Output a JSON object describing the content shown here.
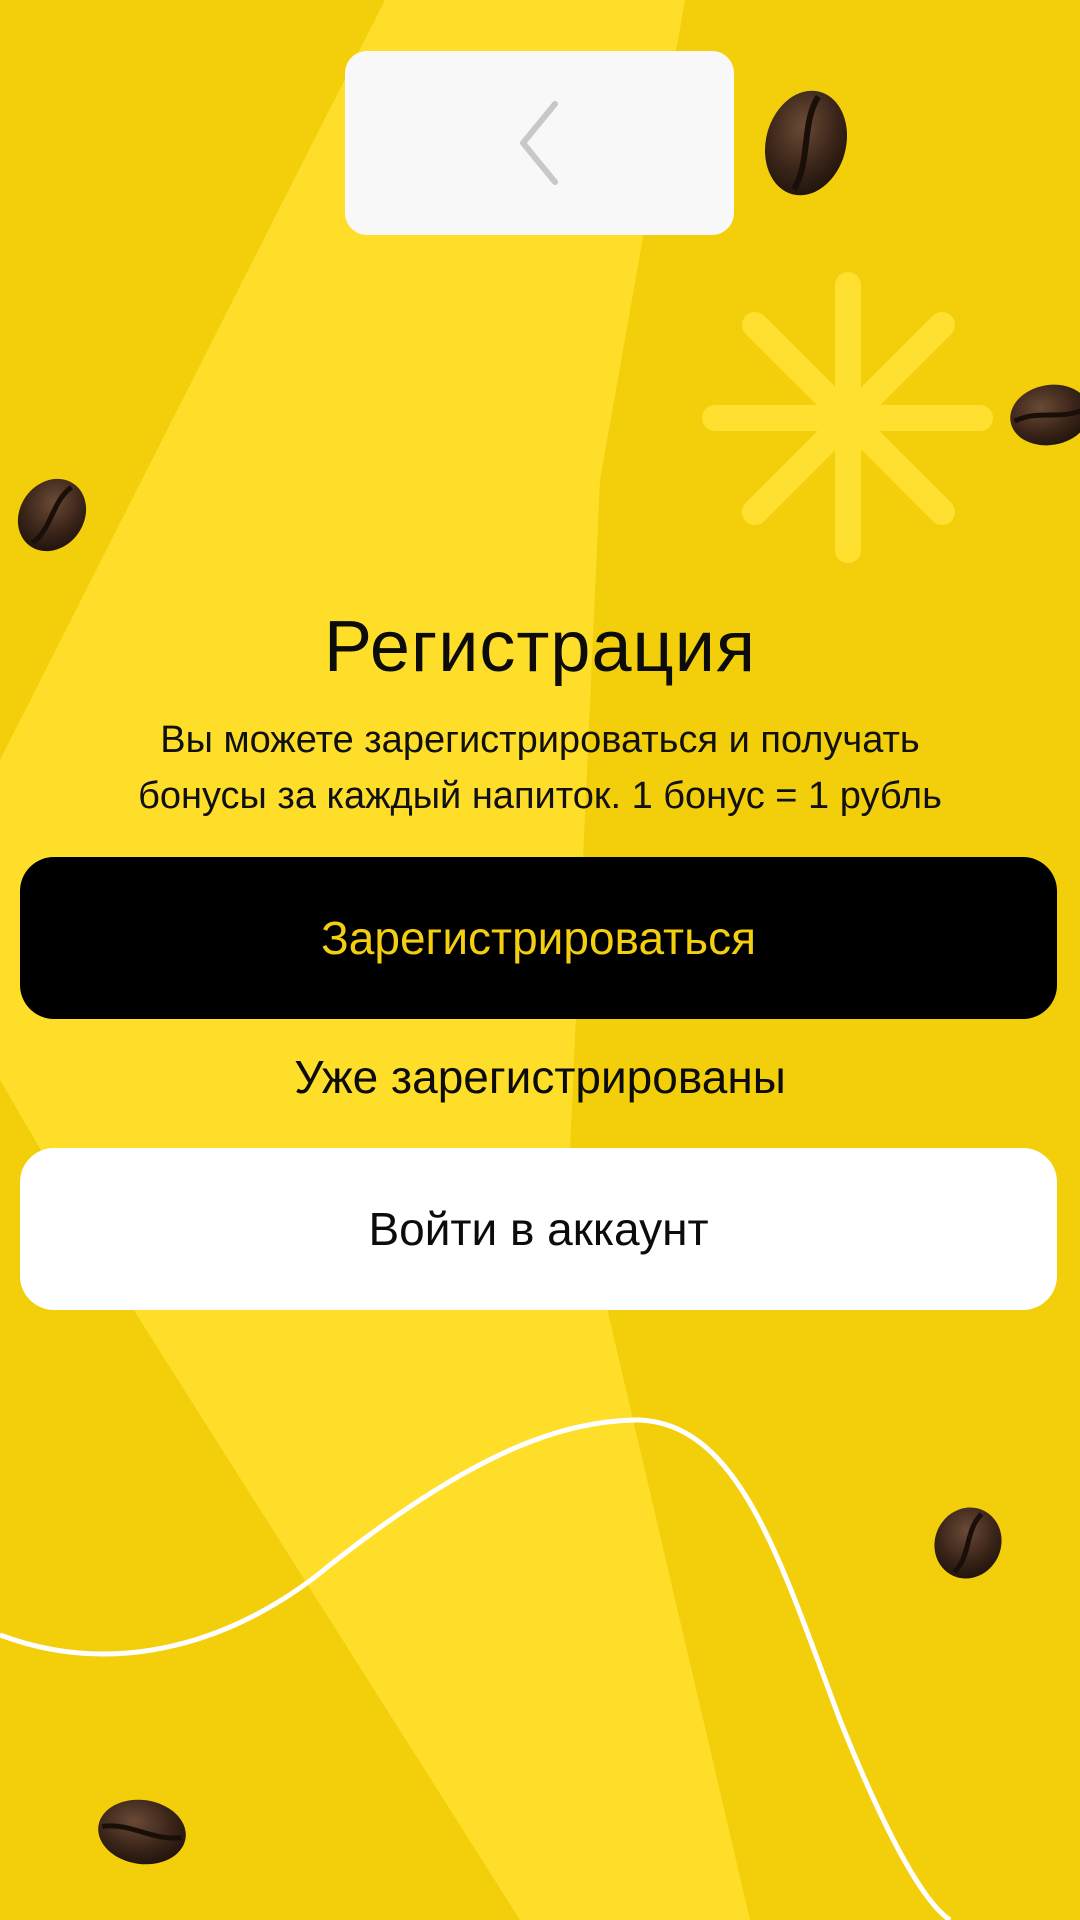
{
  "colors": {
    "background": "#f2cf0a",
    "stripe": "#ffde29",
    "register_button_bg": "#000000",
    "register_button_text": "#f4cf10",
    "login_button_bg": "#ffffff"
  },
  "header": {
    "back_icon": "chevron-left-icon"
  },
  "decor": {
    "icons": [
      "coffee-bean-icon",
      "sparkle-star-icon",
      "wave-line"
    ]
  },
  "main": {
    "title": "Регистрация",
    "subtitle_line1": "Вы можете зарегистрироваться и получать",
    "subtitle_line2": "бонусы за каждый напиток. 1 бонус = 1 рубль",
    "register_label": "Зарегистрироваться",
    "already_registered": "Уже зарегистрированы",
    "login_label": "Войти в аккаунт"
  }
}
